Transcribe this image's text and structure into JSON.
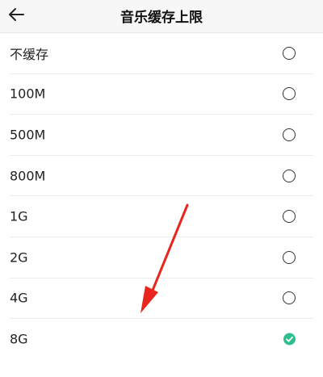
{
  "header": {
    "title": "音乐缓存上限"
  },
  "options": [
    {
      "label": "不缓存",
      "selected": false
    },
    {
      "label": "100M",
      "selected": false
    },
    {
      "label": "500M",
      "selected": false
    },
    {
      "label": "800M",
      "selected": false
    },
    {
      "label": "1G",
      "selected": false
    },
    {
      "label": "2G",
      "selected": false
    },
    {
      "label": "4G",
      "selected": false
    },
    {
      "label": "8G",
      "selected": true
    }
  ],
  "icons": {
    "back": "arrow-left-icon",
    "check": "check-icon"
  },
  "colors": {
    "accent": "#2fbf8f",
    "annotation_arrow": "#e8261e"
  }
}
